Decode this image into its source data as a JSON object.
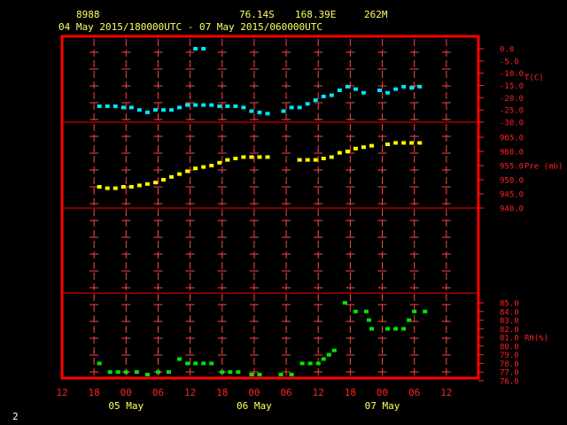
{
  "header": {
    "station": "8988",
    "lat": "76.14S",
    "lon": "168.39E",
    "elev": "262M",
    "range": "04 May 2015/180000UTC - 07 May 2015/060000UTC"
  },
  "footer": {
    "page": "2"
  },
  "colors": {
    "frame": "#ff0000",
    "ticks": "#ff4444",
    "temp": "#00e5ff",
    "pres": "#ffff00",
    "rh": "#00e600",
    "axis_text": "#ff2222",
    "date_text": "#ffff66"
  },
  "chart_data": {
    "type": "scatter",
    "x_units": "hours after 04 May 2015 12UTC",
    "xlim": [
      0,
      78
    ],
    "x_tick_labels": [
      {
        "x": 0,
        "label": "12"
      },
      {
        "x": 6,
        "label": "18"
      },
      {
        "x": 12,
        "label": "00"
      },
      {
        "x": 18,
        "label": "06"
      },
      {
        "x": 24,
        "label": "12"
      },
      {
        "x": 30,
        "label": "18"
      },
      {
        "x": 36,
        "label": "00"
      },
      {
        "x": 42,
        "label": "06"
      },
      {
        "x": 48,
        "label": "12"
      },
      {
        "x": 54,
        "label": "18"
      },
      {
        "x": 60,
        "label": "00"
      },
      {
        "x": 66,
        "label": "06"
      },
      {
        "x": 72,
        "label": "12"
      }
    ],
    "date_labels": [
      {
        "x": 12,
        "label": "05 May"
      },
      {
        "x": 36,
        "label": "06 May"
      },
      {
        "x": 60,
        "label": "07 May"
      }
    ],
    "panels": [
      {
        "id": "temperature",
        "label": "T(C)",
        "ylim": [
          -30,
          0
        ],
        "yticks": [
          {
            "v": 0,
            "label": "0.0"
          },
          {
            "v": -5,
            "label": "-5.0"
          },
          {
            "v": -10,
            "label": "-10.0"
          },
          {
            "v": -15,
            "label": "-15.0"
          },
          {
            "v": -20,
            "label": "-20.0"
          },
          {
            "v": -25,
            "label": "-25.0"
          },
          {
            "v": -30,
            "label": "-30.0"
          }
        ],
        "label_at": -11.5,
        "points": [
          [
            7,
            -23.5
          ],
          [
            8.5,
            -23.5
          ],
          [
            10,
            -23.5
          ],
          [
            11.5,
            -24
          ],
          [
            13,
            -24
          ],
          [
            14.5,
            -25
          ],
          [
            16,
            -26
          ],
          [
            17.5,
            -25
          ],
          [
            19,
            -25
          ],
          [
            20.5,
            -25
          ],
          [
            22,
            -24
          ],
          [
            23.5,
            -23
          ],
          [
            25,
            -23
          ],
          [
            26.5,
            -23
          ],
          [
            28,
            -23
          ],
          [
            29.5,
            -23.5
          ],
          [
            31,
            -23.5
          ],
          [
            32.5,
            -23.5
          ],
          [
            34,
            -24
          ],
          [
            35.5,
            -25.5
          ],
          [
            37,
            -26
          ],
          [
            38.5,
            -26.5
          ],
          [
            41.5,
            -25.5
          ],
          [
            43,
            -24
          ],
          [
            44.5,
            -24
          ],
          [
            46,
            -22.5
          ],
          [
            47.5,
            -21
          ],
          [
            49,
            -19.5
          ],
          [
            50.5,
            -19
          ],
          [
            52,
            -17
          ],
          [
            53.5,
            -15.5
          ],
          [
            55,
            -16.5
          ],
          [
            56.5,
            -18
          ],
          [
            59.5,
            -17
          ],
          [
            61,
            -18
          ],
          [
            62.5,
            -16.5
          ],
          [
            64,
            -15.5
          ],
          [
            65.5,
            -16
          ],
          [
            67,
            -15.5
          ],
          [
            25,
            0
          ],
          [
            26.5,
            0
          ]
        ]
      },
      {
        "id": "pressure",
        "label": "Pre (mb)",
        "ylim": [
          940,
          965
        ],
        "yticks": [
          {
            "v": 965,
            "label": "965.0"
          },
          {
            "v": 960,
            "label": "960.0"
          },
          {
            "v": 955,
            "label": "955.0"
          },
          {
            "v": 950,
            "label": "950.0"
          },
          {
            "v": 945,
            "label": "945.0"
          },
          {
            "v": 940,
            "label": "940.0"
          }
        ],
        "label_at": 955,
        "points": [
          [
            7,
            947.5
          ],
          [
            8.5,
            947
          ],
          [
            10,
            947
          ],
          [
            11.5,
            947.5
          ],
          [
            13,
            947.5
          ],
          [
            14.5,
            948
          ],
          [
            16,
            948.5
          ],
          [
            17.5,
            949
          ],
          [
            19,
            950
          ],
          [
            20.5,
            951
          ],
          [
            22,
            952
          ],
          [
            23.5,
            953
          ],
          [
            25,
            954
          ],
          [
            26.5,
            954.5
          ],
          [
            28,
            955
          ],
          [
            29.5,
            956
          ],
          [
            31,
            957
          ],
          [
            32.5,
            957.5
          ],
          [
            34,
            958
          ],
          [
            35.5,
            958
          ],
          [
            37,
            958
          ],
          [
            38.5,
            958
          ],
          [
            44.5,
            957
          ],
          [
            46,
            957
          ],
          [
            47.5,
            957
          ],
          [
            49,
            957.5
          ],
          [
            50.5,
            958
          ],
          [
            52,
            959.5
          ],
          [
            53.5,
            960
          ],
          [
            55,
            961
          ],
          [
            56.5,
            961.5
          ],
          [
            58,
            962
          ],
          [
            61,
            962.5
          ],
          [
            62.5,
            963
          ],
          [
            64,
            963
          ],
          [
            65.5,
            963
          ],
          [
            67,
            963
          ]
        ]
      },
      {
        "id": "rh",
        "label": "RH(%)",
        "ylim": [
          76,
          85
        ],
        "yticks": [
          {
            "v": 85,
            "label": "85.0"
          },
          {
            "v": 84,
            "label": "84.0"
          },
          {
            "v": 83,
            "label": "83.0"
          },
          {
            "v": 82,
            "label": "82.0"
          },
          {
            "v": 81,
            "label": "81.0"
          },
          {
            "v": 80,
            "label": "80.0"
          },
          {
            "v": 79,
            "label": "79.0"
          },
          {
            "v": 78,
            "label": "78.0"
          },
          {
            "v": 77,
            "label": "77.0"
          },
          {
            "v": 76,
            "label": "76.0"
          }
        ],
        "label_at": 81,
        "points": [
          [
            7,
            78
          ],
          [
            9,
            77
          ],
          [
            10.5,
            77
          ],
          [
            12,
            77
          ],
          [
            14,
            77
          ],
          [
            16,
            76
          ],
          [
            18,
            77
          ],
          [
            20,
            77
          ],
          [
            22,
            78.5
          ],
          [
            23.5,
            78
          ],
          [
            25,
            78
          ],
          [
            26.5,
            78
          ],
          [
            28,
            78
          ],
          [
            30,
            77
          ],
          [
            31.5,
            77
          ],
          [
            33,
            77
          ],
          [
            35.5,
            76
          ],
          [
            37,
            76
          ],
          [
            41,
            76
          ],
          [
            43,
            76
          ],
          [
            45,
            78
          ],
          [
            46.5,
            78
          ],
          [
            48,
            78
          ],
          [
            49,
            78.5
          ],
          [
            50,
            79
          ],
          [
            51,
            79.5
          ],
          [
            53,
            85
          ],
          [
            55,
            84
          ],
          [
            57,
            84
          ],
          [
            57.5,
            83
          ],
          [
            58,
            82
          ],
          [
            61,
            82
          ],
          [
            62.5,
            82
          ],
          [
            64,
            82
          ],
          [
            65,
            83
          ],
          [
            66,
            84
          ],
          [
            68,
            84
          ]
        ]
      }
    ]
  }
}
